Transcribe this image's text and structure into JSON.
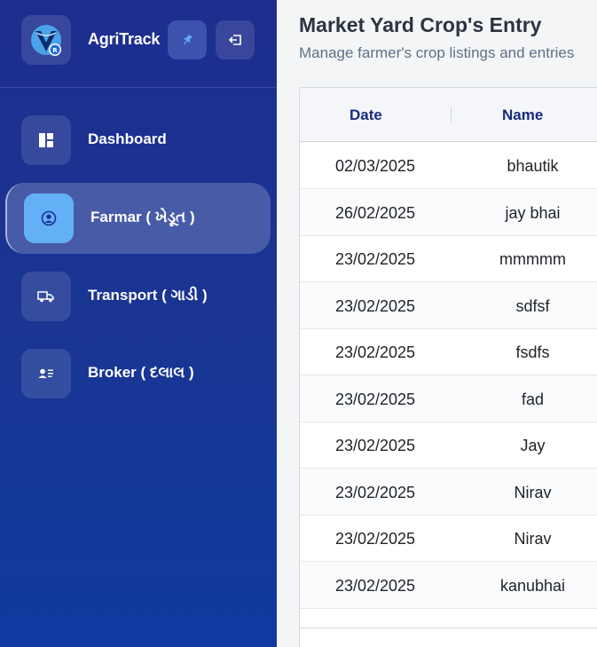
{
  "app": {
    "name": "AgriTrack"
  },
  "colors": {
    "sidebar": "#1d2d8f",
    "accent": "#63b0f7",
    "header_text": "#1a2a7a"
  },
  "brand_buttons": {
    "pin_icon": "pin-icon",
    "exit_icon": "exit-icon"
  },
  "nav": {
    "items": [
      {
        "label": "Dashboard",
        "icon": "dashboard-icon"
      },
      {
        "label": "Farmar ( ખેડૂત )",
        "icon": "user-circle-icon",
        "active": true
      },
      {
        "label": "Transport ( ગાડી )",
        "icon": "truck-icon"
      },
      {
        "label": "Broker ( દલાલ )",
        "icon": "id-card-icon"
      }
    ]
  },
  "page": {
    "title": "Market Yard Crop's Entry",
    "subtitle": "Manage farmer's crop listings and entries"
  },
  "table": {
    "columns": [
      "Date",
      "Name"
    ],
    "rows": [
      {
        "date": "02/03/2025",
        "name": "bhautik"
      },
      {
        "date": "26/02/2025",
        "name": "jay bhai"
      },
      {
        "date": "23/02/2025",
        "name": "mmmmm"
      },
      {
        "date": "23/02/2025",
        "name": "sdfsf"
      },
      {
        "date": "23/02/2025",
        "name": "fsdfs"
      },
      {
        "date": "23/02/2025",
        "name": "fad"
      },
      {
        "date": "23/02/2025",
        "name": "Jay"
      },
      {
        "date": "23/02/2025",
        "name": "Nirav"
      },
      {
        "date": "23/02/2025",
        "name": "Nirav"
      },
      {
        "date": "23/02/2025",
        "name": "kanubhai"
      }
    ]
  }
}
